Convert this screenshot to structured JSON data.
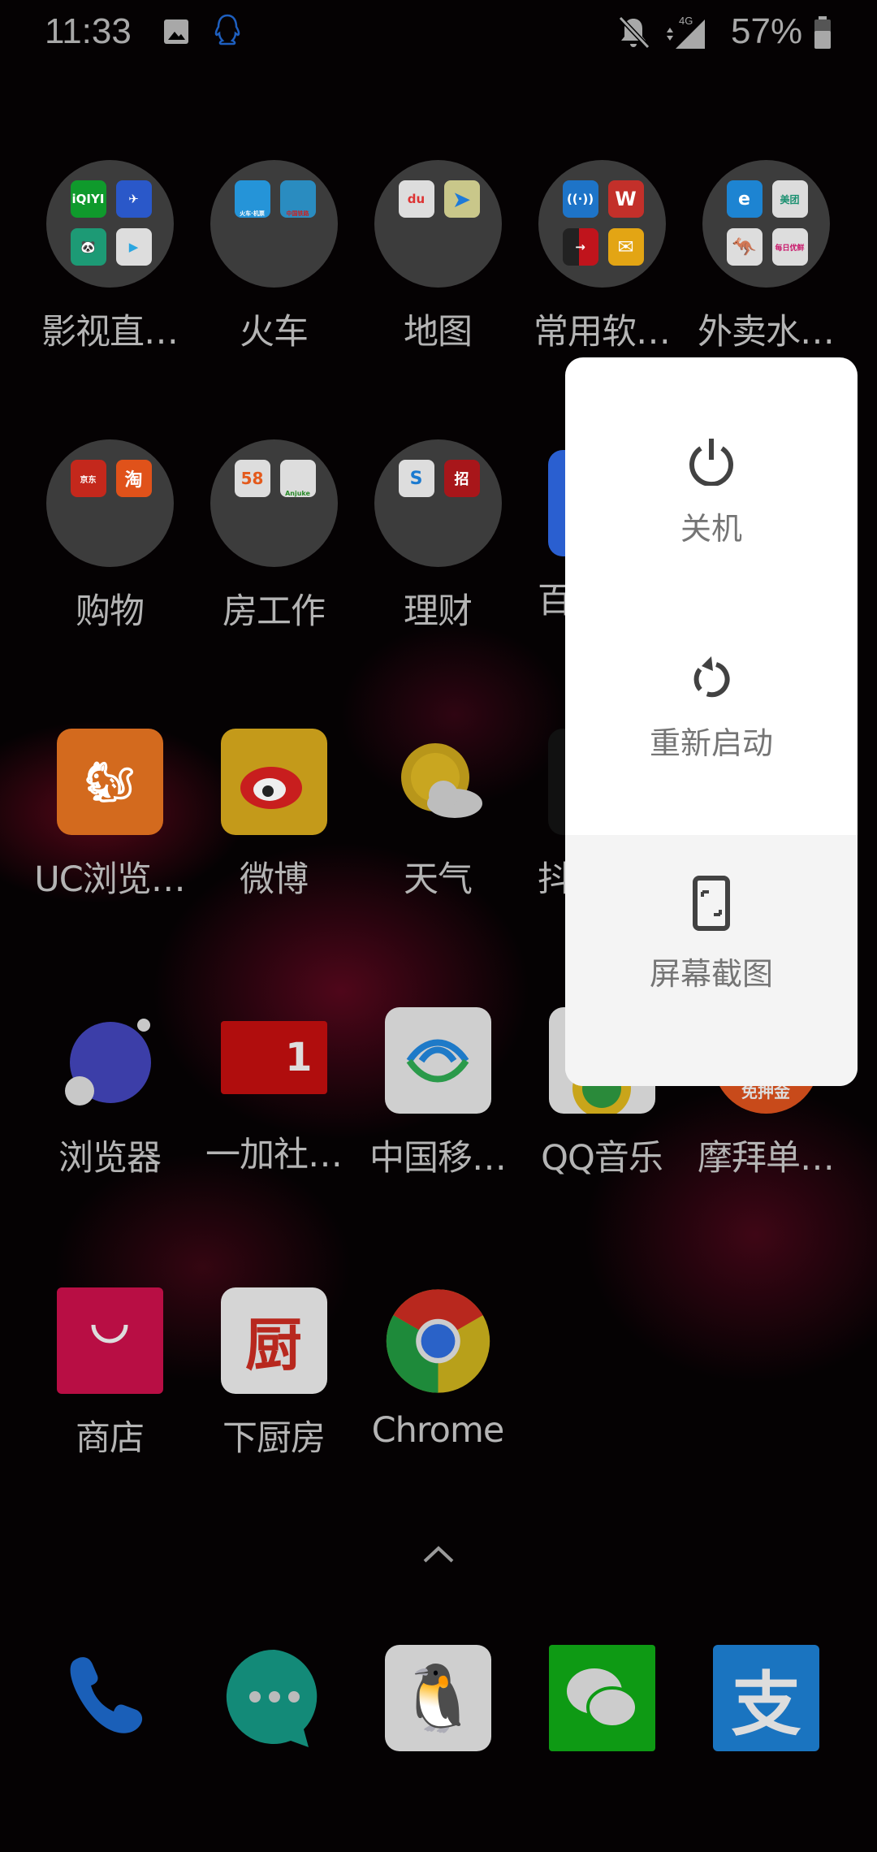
{
  "status_bar": {
    "time": "11:33",
    "battery": "57%",
    "network": "4G",
    "icons": [
      "image-icon",
      "qq-icon",
      "mute-bell-icon",
      "data-arrows-icon",
      "signal-icon",
      "battery-icon"
    ]
  },
  "rows": [
    [
      {
        "label": "影视直…",
        "type": "folder"
      },
      {
        "label": "火车",
        "type": "folder"
      },
      {
        "label": "地图",
        "type": "folder"
      },
      {
        "label": "常用软…",
        "type": "folder"
      },
      {
        "label": "外卖水…",
        "type": "folder"
      }
    ],
    [
      {
        "label": "购物",
        "type": "folder"
      },
      {
        "label": "房工作",
        "type": "folder"
      },
      {
        "label": "理财",
        "type": "folder"
      },
      {
        "label": "百",
        "type": "app"
      }
    ],
    [
      {
        "label": "UC浏览…"
      },
      {
        "label": "微博"
      },
      {
        "label": "天气"
      },
      {
        "label": "抖"
      }
    ],
    [
      {
        "label": "浏览器"
      },
      {
        "label": "一加社…",
        "badge": "1"
      },
      {
        "label": "中国移…"
      },
      {
        "label": "QQ音乐"
      },
      {
        "label": "摩拜单…",
        "badge": "免押金"
      }
    ],
    [
      {
        "label": "商店"
      },
      {
        "label": "下厨房",
        "glyph": "厨"
      },
      {
        "label": "Chrome"
      }
    ]
  ],
  "folder_minis": {
    "f0": [
      "iQIYI",
      "",
      "",
      ""
    ],
    "f1": [
      "火车·机票",
      "中国铁路"
    ],
    "f2": [
      "du",
      ""
    ],
    "f3": [
      "",
      "W",
      "",
      ""
    ],
    "f4": [
      "e",
      "美团",
      "",
      "每日优鲜"
    ],
    "f5": [
      "京东",
      "淘"
    ],
    "f6": [
      "58",
      "Anjuke"
    ],
    "f7": [
      "",
      "招"
    ]
  },
  "power_menu": {
    "items": [
      {
        "label": "关机",
        "icon": "power-icon"
      },
      {
        "label": "重新启动",
        "icon": "restart-icon"
      },
      {
        "label": "屏幕截图",
        "icon": "screenshot-icon",
        "highlighted": true
      }
    ]
  },
  "dock": [
    "phone",
    "messages",
    "qq",
    "wechat",
    "alipay"
  ],
  "dock_glyphs": {
    "alipay": "支"
  }
}
